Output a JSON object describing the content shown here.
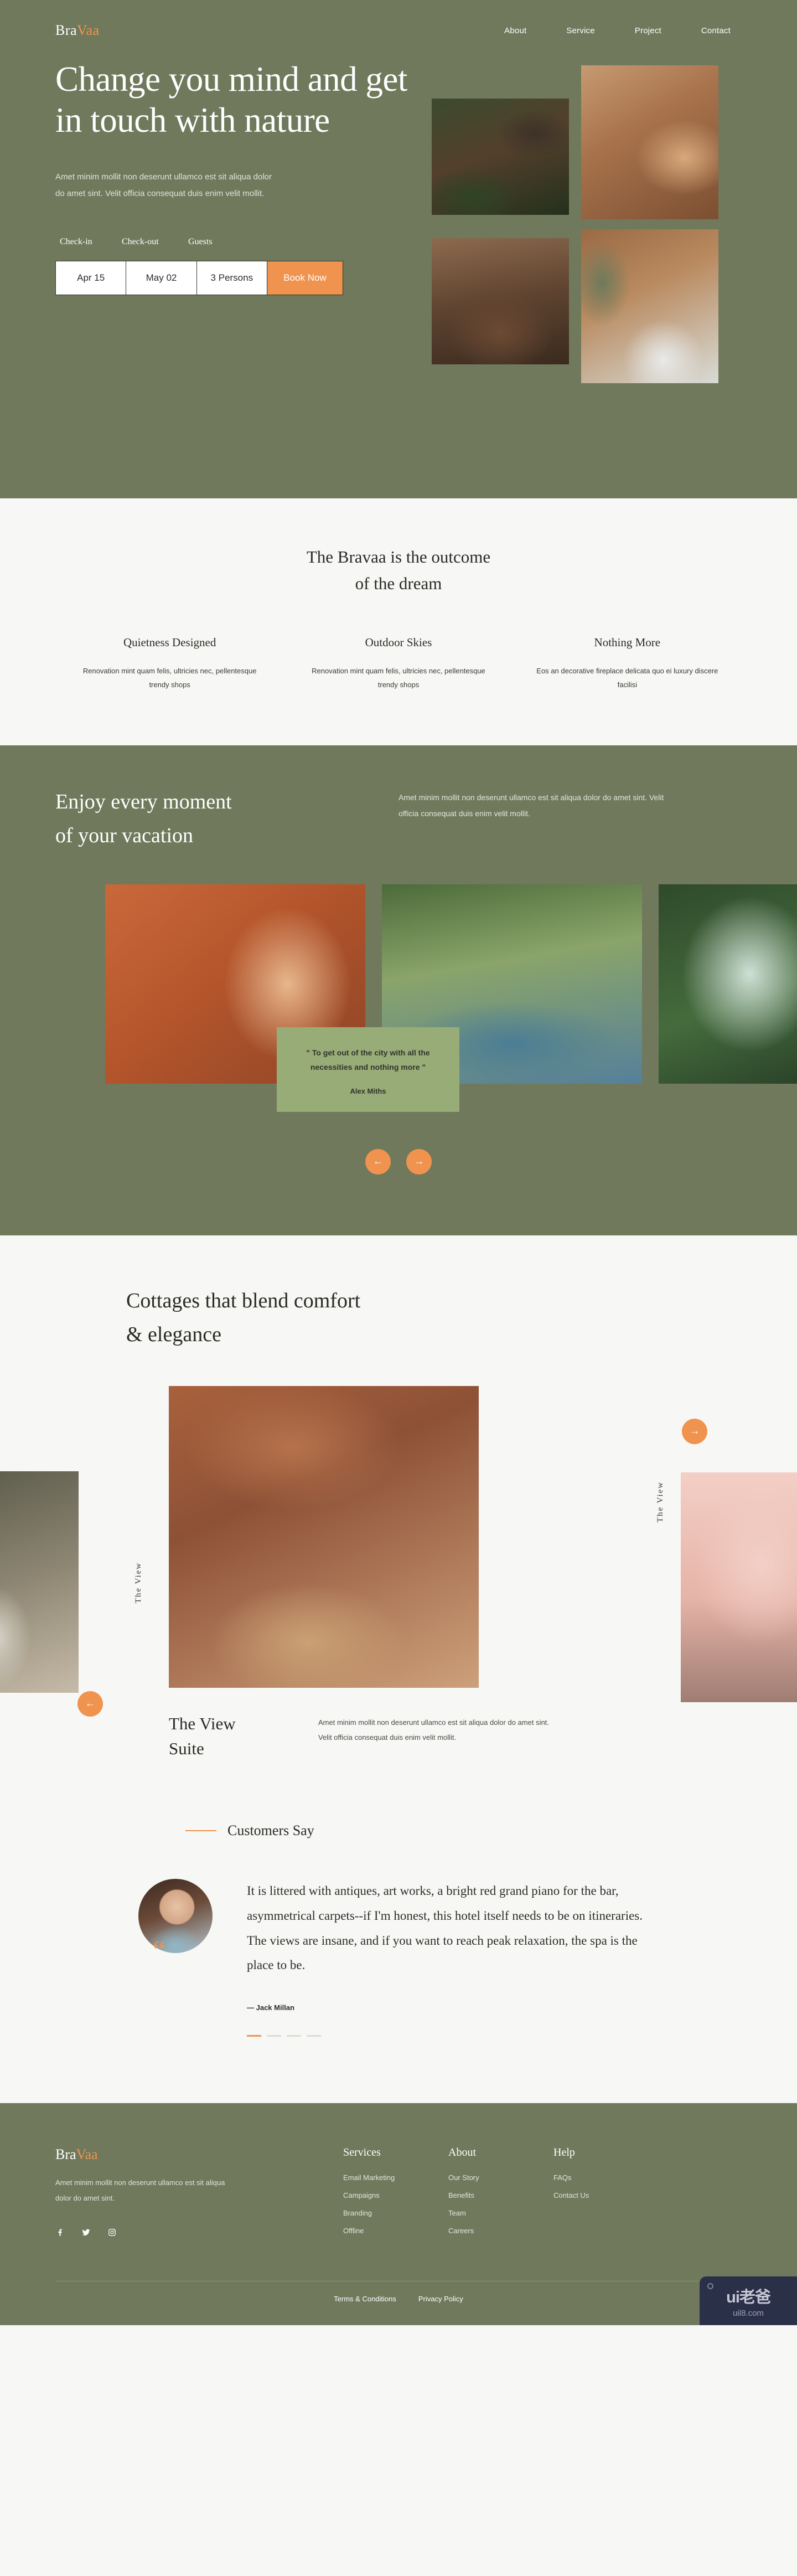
{
  "brand": {
    "part1": "Bra",
    "part2": "Vaa",
    "accent_color": "#f0934e"
  },
  "nav": {
    "items": [
      "About",
      "Service",
      "Project",
      "Contact"
    ]
  },
  "hero": {
    "title": "Change you mind and get in touch with nature",
    "subtitle": "Amet minim mollit non deserunt ullamco est sit aliqua dolor do amet sint. Velit officia consequat duis enim velit mollit.",
    "booking": {
      "labels": [
        "Check-in",
        "Check-out",
        "Guests"
      ],
      "checkin": "Apr 15",
      "checkout": "May 02",
      "guests": "3 Persons",
      "cta": "Book Now"
    },
    "images": [
      "forest-cabin",
      "balcony-mountain-view",
      "snowy-log-cabin",
      "cabin-bedroom-reading"
    ]
  },
  "outcome": {
    "title_line1": "The Bravaa is the outcome",
    "title_line2": "of the dream",
    "features": [
      {
        "title": "Quietness Designed",
        "desc": "Renovation mint quam felis, ultricies nec, pellentesque trendy shops"
      },
      {
        "title": "Outdoor Skies",
        "desc": "Renovation mint quam felis, ultricies nec, pellentesque trendy shops"
      },
      {
        "title": "Nothing More",
        "desc": "Eos an decorative fireplace delicata quo ei luxury discere facilisi"
      }
    ]
  },
  "enjoy": {
    "title_line1": "Enjoy every moment",
    "title_line2": "of your vacation",
    "subtitle": "Amet minim mollit non deserunt ullamco est sit aliqua dolor do amet sint. Velit officia consequat duis enim velit mollit.",
    "gallery": [
      "moroccan-riad-interior",
      "resort-pool",
      "waterfall-swing"
    ],
    "quote": "\" To get out of the city with all the necessities and nothing more \"",
    "quote_author": "Alex Miths",
    "prev_icon": "←",
    "next_icon": "→"
  },
  "cottages": {
    "title_line1": "Cottages that blend comfort",
    "title_line2": "& elegance",
    "slide_label": "The View",
    "name_line1": "The View",
    "name_line2": "Suite",
    "desc": "Amet minim mollit non deserunt ullamco est sit aliqua dolor do amet sint. Velit officia consequat duis enim velit mollit.",
    "prev_icon": "←",
    "next_icon": "→"
  },
  "customers": {
    "eyebrow": "Customers Say",
    "quote": "It is littered with antiques, art works, a bright red grand piano for the bar, asymmetrical carpets--if I'm honest, this hotel itself needs to be on itineraries. The views are insane, and if you want to reach peak relaxation, the spa is the place to be.",
    "author": "— Jack Millan",
    "avatar": "customer-portrait",
    "quote_icon": "“",
    "pagination_count": 4,
    "pagination_active": 0
  },
  "footer": {
    "desc": "Amet minim mollit non deserunt ullamco est sit aliqua dolor do amet sint.",
    "social": [
      "facebook-icon",
      "twitter-icon",
      "instagram-icon"
    ],
    "columns": [
      {
        "heading": "Services",
        "links": [
          "Email Marketing",
          "Campaigns",
          "Branding",
          "Offline"
        ]
      },
      {
        "heading": "About",
        "links": [
          "Our Story",
          "Benefits",
          "Team",
          "Careers"
        ]
      },
      {
        "heading": "Help",
        "links": [
          "FAQs",
          "Contact Us"
        ]
      }
    ],
    "bottom_links": [
      "Terms & Conditions",
      "Privacy Policy"
    ]
  },
  "badge": {
    "title": "ui老爸",
    "sub": "uil8.com"
  },
  "colors": {
    "green": "#70795c",
    "light_green": "#98ac77",
    "orange": "#f0934e",
    "offwhite": "#f7f7f5"
  }
}
